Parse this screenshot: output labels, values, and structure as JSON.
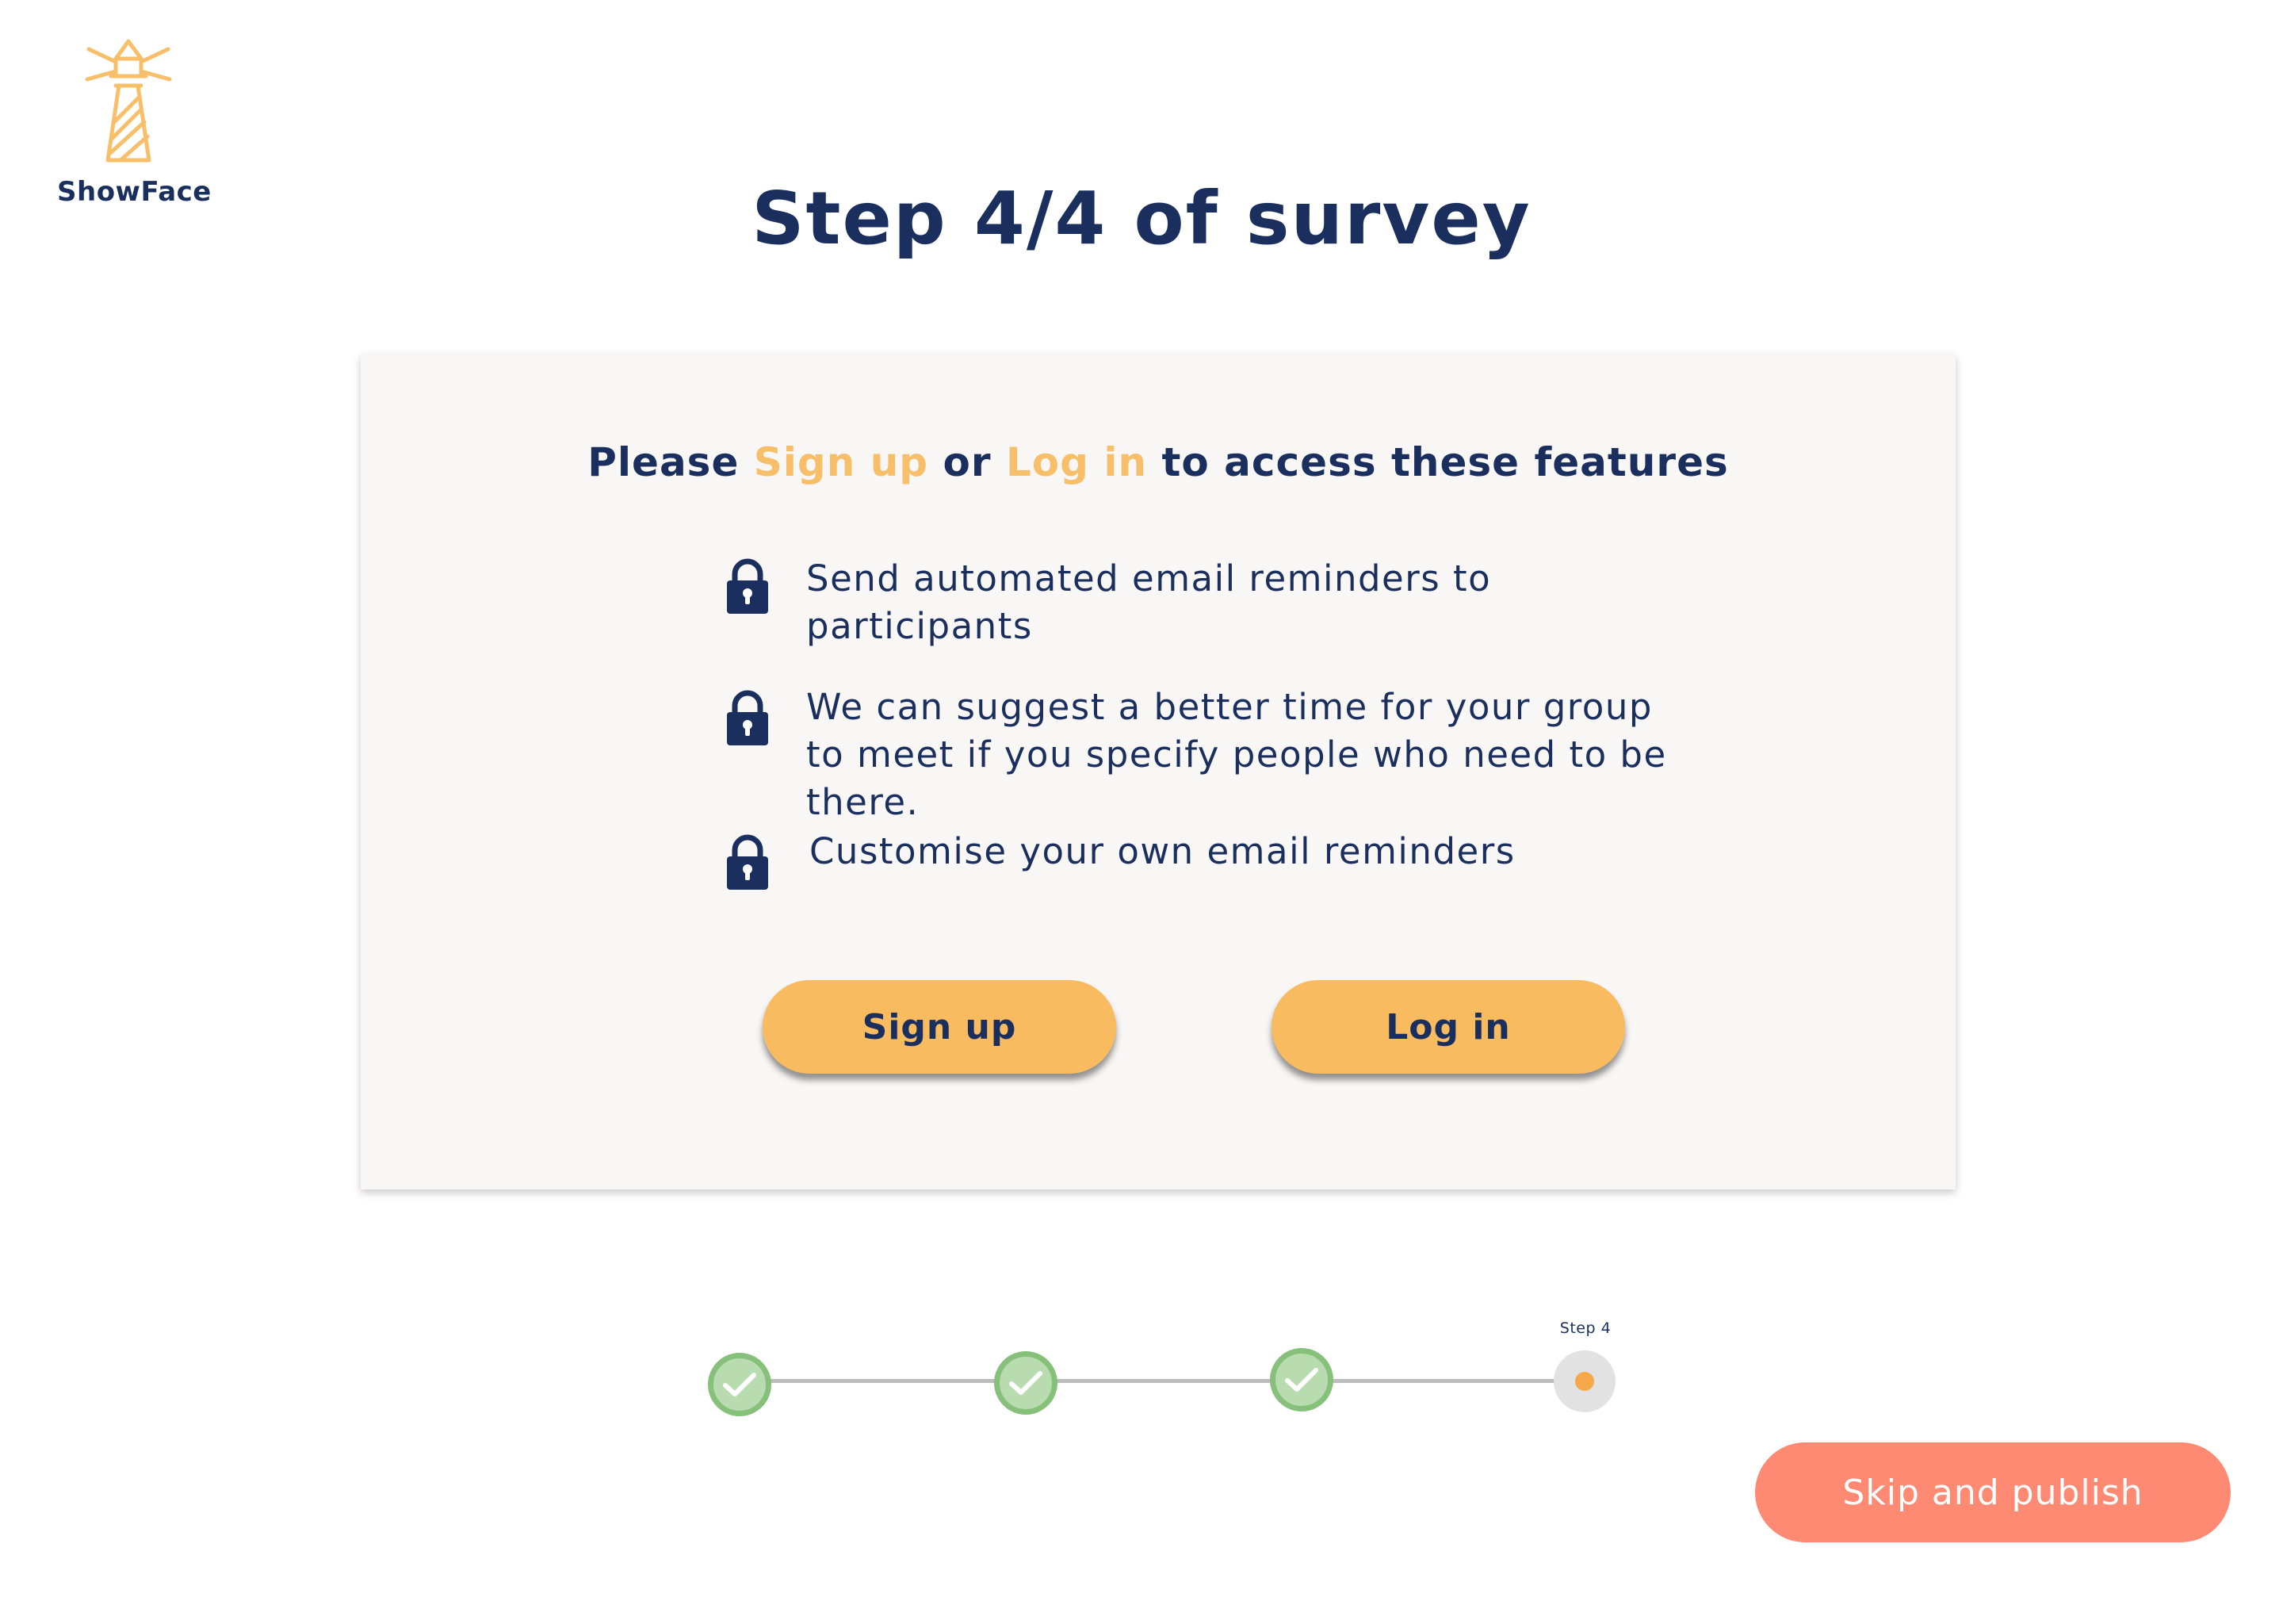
{
  "brand": {
    "name": "ShowFace",
    "logo_icon": "lighthouse-icon",
    "logo_color": "#f8bf6a"
  },
  "page": {
    "title": "Step 4/4 of survey"
  },
  "card": {
    "heading": {
      "prefix": "Please ",
      "signup_link": "Sign up",
      "middle": " or ",
      "login_link": "Log in",
      "suffix": " to access these features"
    },
    "features": [
      {
        "icon": "lock-icon",
        "text": "Send automated email reminders to participants"
      },
      {
        "icon": "lock-icon",
        "text": "We can suggest a better time for your group to meet if you specify people who need to be there."
      },
      {
        "icon": "lock-icon",
        "text": "Customise your own email reminders"
      }
    ],
    "signup_button": "Sign up",
    "login_button": "Log in"
  },
  "progress": {
    "current_step_label": "Step 4",
    "current_step": 4,
    "total_steps": 4,
    "steps": [
      {
        "state": "completed",
        "icon": "check-icon"
      },
      {
        "state": "completed",
        "icon": "check-icon"
      },
      {
        "state": "completed",
        "icon": "check-icon"
      },
      {
        "state": "current"
      }
    ]
  },
  "actions": {
    "skip_publish": "Skip and publish"
  },
  "colors": {
    "primary_text": "#1b2f5e",
    "accent": "#f8bf6a",
    "button": "#f8bb5f",
    "skip_button": "#ff8a73",
    "completed_step": "#86c07a",
    "current_dot": "#f6a94a"
  }
}
